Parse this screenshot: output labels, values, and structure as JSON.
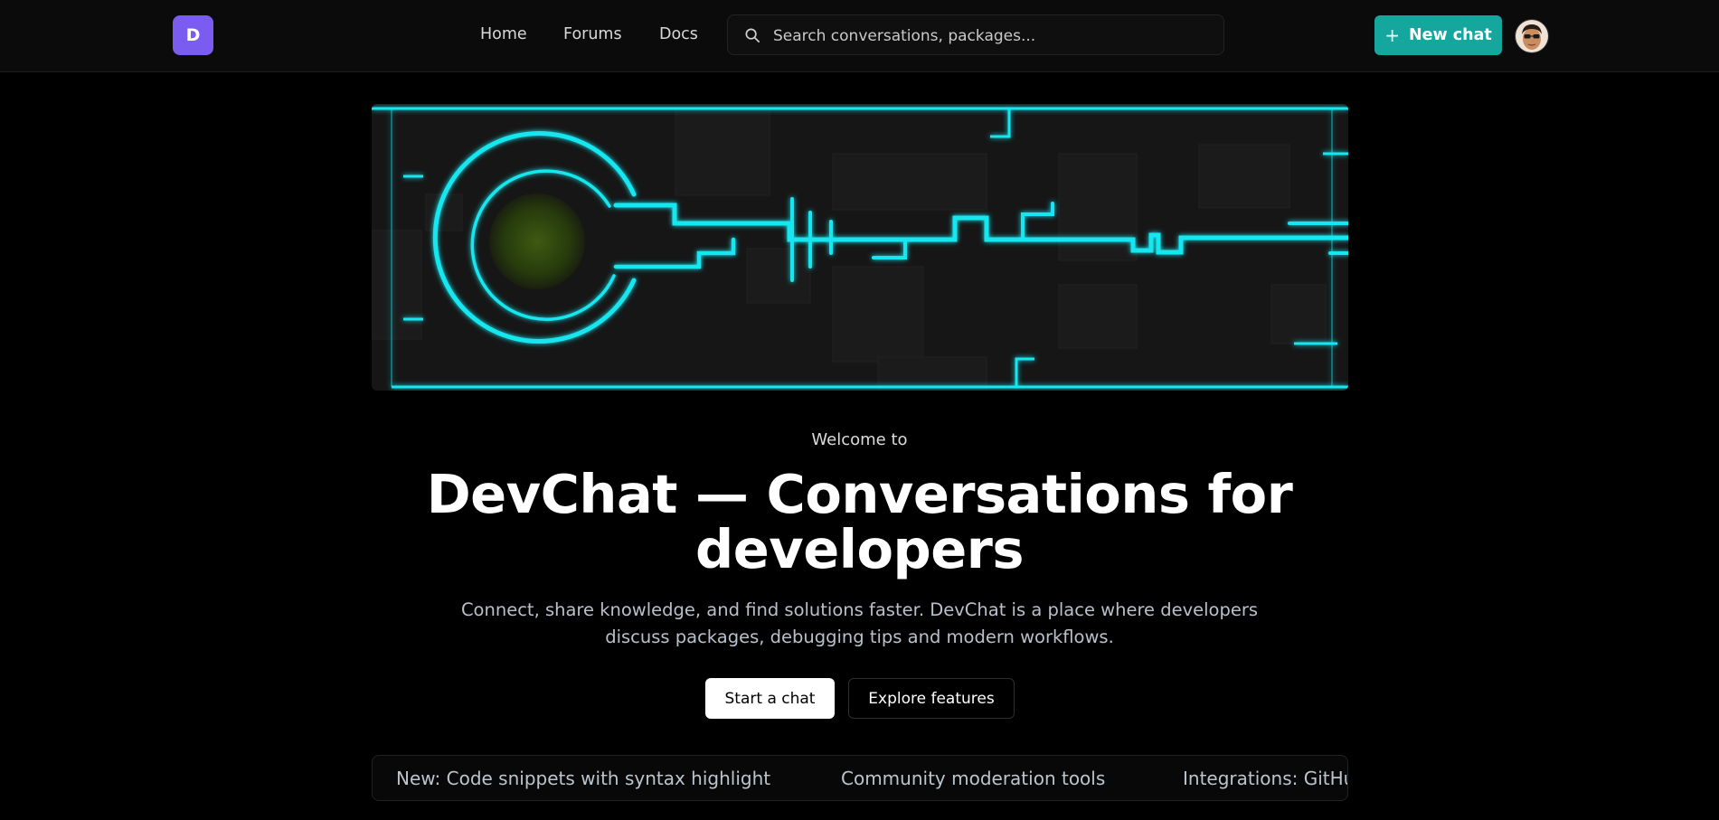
{
  "brand": {
    "logo_letter": "D",
    "logo_color": "#7b5cf0"
  },
  "nav": {
    "items": [
      {
        "label": "Home"
      },
      {
        "label": "Forums"
      },
      {
        "label": "Docs"
      }
    ]
  },
  "search": {
    "placeholder": "Search conversations, packages..."
  },
  "header": {
    "new_chat_icon": "+",
    "new_chat_label": "New chat",
    "accent": "#15a69e"
  },
  "banner": {
    "accent": "#19e6f0"
  },
  "hero": {
    "eyebrow": "Welcome to",
    "title": "DevChat — Conversations for developers",
    "subtitle": "Connect, share knowledge, and find solutions faster. DevChat is a place where developers discuss packages, debugging tips and modern workflows.",
    "primary_cta": "Start a chat",
    "secondary_cta": "Explore features"
  },
  "ticker": {
    "items": [
      "New: Code snippets with syntax highlight",
      "Community moderation tools",
      "Integrations: GitHub"
    ]
  }
}
